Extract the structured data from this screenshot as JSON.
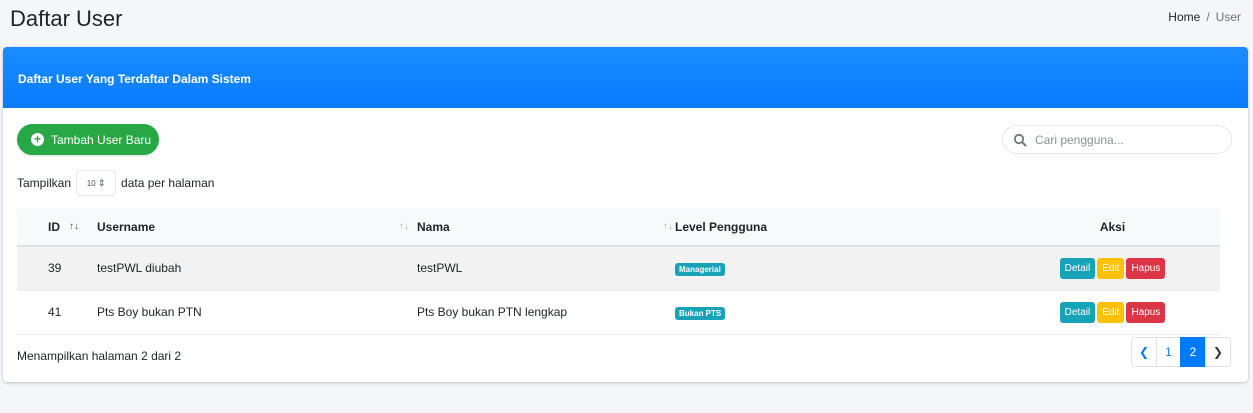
{
  "page": {
    "title": "Daftar User",
    "breadcrumb": [
      {
        "label": "Home"
      },
      {
        "label": "User"
      }
    ],
    "breadcrumb_separator": "/"
  },
  "card": {
    "title": "Daftar User Yang Terdaftar Dalam Sistem",
    "header_color": "#0a7bff"
  },
  "toolbar": {
    "add_label": "Tambah User Baru",
    "search_placeholder": "Cari pengguna..."
  },
  "length": {
    "prefix": "Tampilkan",
    "value": "10",
    "suffix": "data per halaman"
  },
  "table": {
    "columns": [
      "ID",
      "Username",
      "Nama",
      "Level Pengguna",
      "Aksi"
    ],
    "rows": [
      {
        "id": "39",
        "username": "testPWL diubah",
        "nama": "testPWL",
        "level": "Managerial"
      },
      {
        "id": "41",
        "username": "Pts Boy bukan PTN",
        "nama": "Pts Boy bukan PTN lengkap",
        "level": "Bukan PTS"
      }
    ],
    "actions": {
      "detail": "Detail",
      "edit": "Edit",
      "delete": "Hapus"
    }
  },
  "footer": {
    "info": "Menampilkan halaman 2 dari 2"
  },
  "pagination": {
    "pages": [
      "1",
      "2"
    ],
    "current": "2"
  },
  "colors": {
    "primary": "#007bff",
    "success": "#28a745",
    "info": "#17a2b8",
    "warning": "#ffc107",
    "danger": "#dc3545"
  }
}
